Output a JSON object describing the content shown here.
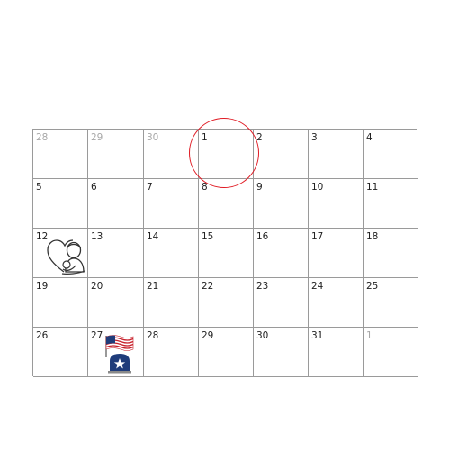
{
  "weeks": [
    [
      {
        "label": "28",
        "other_month": true
      },
      {
        "label": "29",
        "other_month": true
      },
      {
        "label": "30",
        "other_month": true
      },
      {
        "label": "1",
        "other_month": false
      },
      {
        "label": "2",
        "other_month": false
      },
      {
        "label": "3",
        "other_month": false
      },
      {
        "label": "4",
        "other_month": false
      }
    ],
    [
      {
        "label": "5",
        "other_month": false
      },
      {
        "label": "6",
        "other_month": false
      },
      {
        "label": "7",
        "other_month": false
      },
      {
        "label": "8",
        "other_month": false
      },
      {
        "label": "9",
        "other_month": false
      },
      {
        "label": "10",
        "other_month": false
      },
      {
        "label": "11",
        "other_month": false
      }
    ],
    [
      {
        "label": "12",
        "other_month": false,
        "icon": "mothers-day-icon"
      },
      {
        "label": "13",
        "other_month": false
      },
      {
        "label": "14",
        "other_month": false
      },
      {
        "label": "15",
        "other_month": false
      },
      {
        "label": "16",
        "other_month": false
      },
      {
        "label": "17",
        "other_month": false
      },
      {
        "label": "18",
        "other_month": false
      }
    ],
    [
      {
        "label": "19",
        "other_month": false
      },
      {
        "label": "20",
        "other_month": false
      },
      {
        "label": "21",
        "other_month": false
      },
      {
        "label": "22",
        "other_month": false
      },
      {
        "label": "23",
        "other_month": false
      },
      {
        "label": "24",
        "other_month": false
      },
      {
        "label": "25",
        "other_month": false
      }
    ],
    [
      {
        "label": "26",
        "other_month": false
      },
      {
        "label": "27",
        "other_month": false,
        "icon": "memorial-day-flag-icon"
      },
      {
        "label": "28",
        "other_month": false
      },
      {
        "label": "29",
        "other_month": false
      },
      {
        "label": "30",
        "other_month": false
      },
      {
        "label": "31",
        "other_month": false
      },
      {
        "label": "1",
        "other_month": true
      }
    ]
  ],
  "highlighted_day": "1",
  "colors": {
    "grid_line": "#9a9a9a",
    "highlight": "#e01b24",
    "other_month_text": "#a8a8a8",
    "flag_blue": "#1f3c7a",
    "flag_red": "#c8202b"
  }
}
